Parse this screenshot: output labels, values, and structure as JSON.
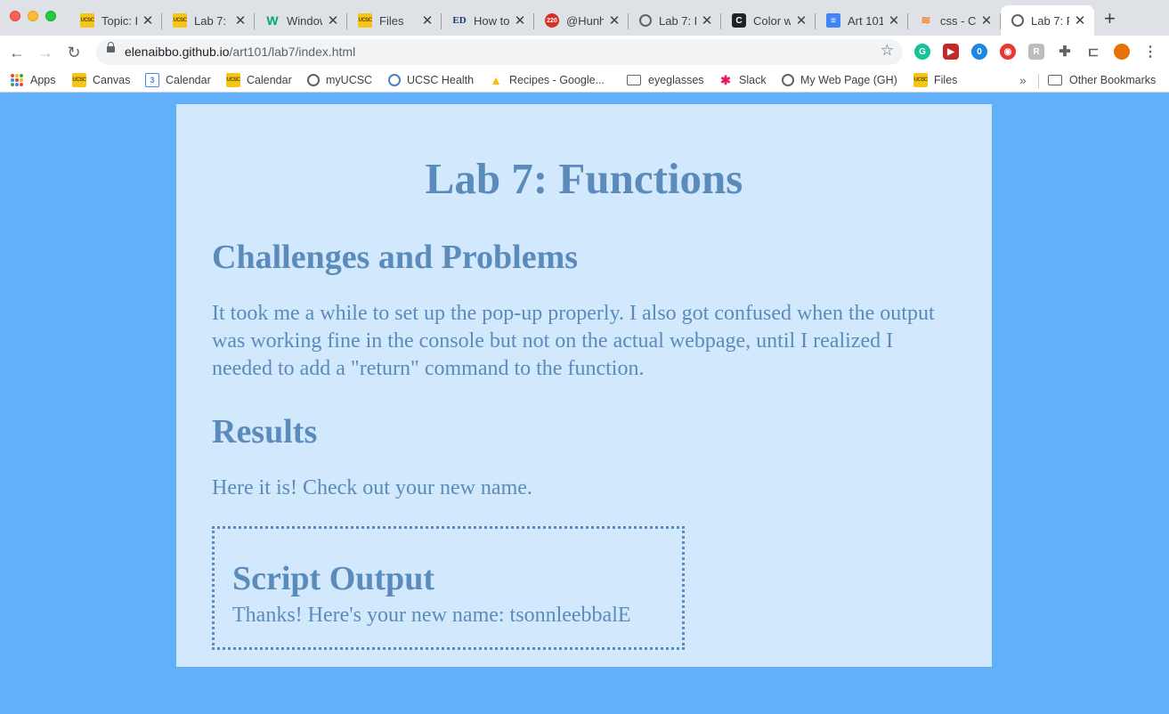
{
  "browser": {
    "tabs": [
      {
        "title": "Topic: P",
        "favicon": "ucsc-icon",
        "active": false
      },
      {
        "title": "Lab 7: F",
        "favicon": "ucsc-icon",
        "active": false
      },
      {
        "title": "Window",
        "favicon": "w3schools-icon",
        "active": false
      },
      {
        "title": "Files",
        "favicon": "ucsc-icon",
        "active": false
      },
      {
        "title": "How to",
        "favicon": "ed-icon",
        "active": false
      },
      {
        "title": "@Hunh",
        "favicon": "calendar-badge-icon",
        "badge": "220",
        "active": false
      },
      {
        "title": "Lab 7: F",
        "favicon": "globe-icon",
        "active": false
      },
      {
        "title": "Color w",
        "favicon": "codepen-icon",
        "active": false
      },
      {
        "title": "Art 101",
        "favicon": "google-docs-icon",
        "active": false
      },
      {
        "title": "css - C",
        "favicon": "stackoverflow-icon",
        "active": false
      },
      {
        "title": "Lab 7: F",
        "favicon": "globe-icon",
        "active": true
      }
    ],
    "new_tab_label": "+",
    "url_host": "elenaibbo.github.io",
    "url_path": "/art101/lab7/index.html",
    "extensions": [
      {
        "name": "grammarly-icon",
        "color": "#15c39a",
        "label": "G"
      },
      {
        "name": "ext-red-icon",
        "color": "#c62828",
        "label": "▶"
      },
      {
        "name": "ghost-icon",
        "color": "#1e88e5",
        "label": "0"
      },
      {
        "name": "shield-ext-icon",
        "color": "#e53935",
        "label": "◉"
      },
      {
        "name": "ext-gray-icon",
        "color": "#9e9e9e",
        "label": "R"
      },
      {
        "name": "puzzle-icon",
        "color": "#5f6368",
        "label": "✚"
      },
      {
        "name": "cast-icon",
        "color": "#5f6368",
        "label": "⊏"
      },
      {
        "name": "avatar",
        "color": "#e8710a",
        "label": "●"
      }
    ],
    "bookmarks": [
      {
        "label": "Apps",
        "icon": "apps-grid-icon"
      },
      {
        "label": "Canvas",
        "icon": "ucsc-icon"
      },
      {
        "label": "Calendar",
        "icon": "google-calendar-icon"
      },
      {
        "label": "Calendar",
        "icon": "ucsc-icon"
      },
      {
        "label": "myUCSC",
        "icon": "globe-icon"
      },
      {
        "label": "UCSC Health",
        "icon": "globe-blue-icon"
      },
      {
        "label": "Recipes - Google...",
        "icon": "google-drive-icon"
      },
      {
        "label": "eyeglasses",
        "icon": "folder-icon"
      },
      {
        "label": "Slack",
        "icon": "slack-icon"
      },
      {
        "label": "My Web Page (GH)",
        "icon": "globe-icon"
      },
      {
        "label": "Files",
        "icon": "ucsc-icon"
      }
    ],
    "bookmarks_overflow": "»",
    "other_bookmarks": "Other Bookmarks",
    "calendar_day": "3"
  },
  "page": {
    "title": "Lab 7: Functions",
    "challenges_heading": "Challenges and Problems",
    "challenges_text": "It took me a while to set up the pop-up properly. I also got confused when the output was working fine in the console but not on the actual webpage, until I realized I needed to add a \"return\" command to the function.",
    "results_heading": "Results",
    "results_text": "Here it is! Check out your new name.",
    "output_heading": "Script Output",
    "output_text": "Thanks! Here's your new name: tsonnleebbalE"
  },
  "colors": {
    "page_background": "#62b0fa",
    "card_background": "#d2e8fc",
    "text": "#5b8bbb"
  }
}
